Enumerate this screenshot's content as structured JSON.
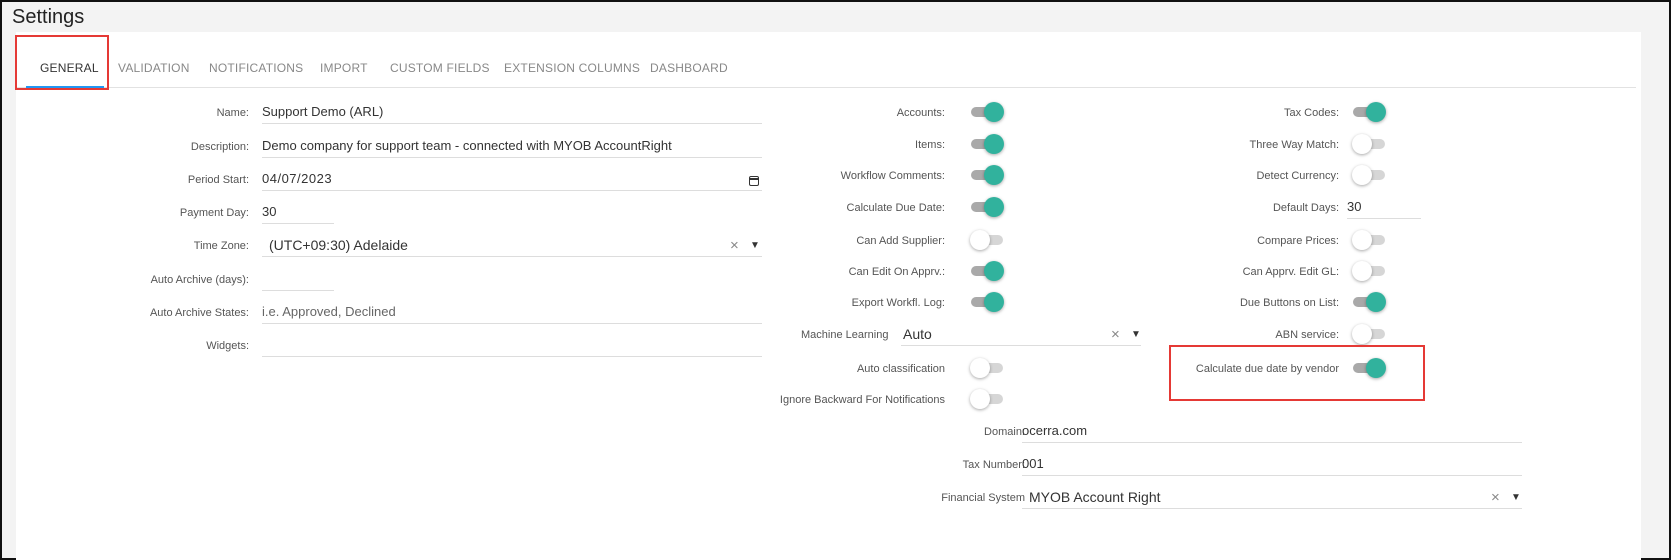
{
  "page_title": "Settings",
  "tabs": [
    {
      "label": "GENERAL",
      "active": true
    },
    {
      "label": "VALIDATION"
    },
    {
      "label": "NOTIFICATIONS"
    },
    {
      "label": "IMPORT"
    },
    {
      "label": "CUSTOM FIELDS"
    },
    {
      "label": "EXTENSION COLUMNS"
    },
    {
      "label": "DASHBOARD"
    }
  ],
  "general": {
    "name": {
      "label": "Name:",
      "value": "Support Demo (ARL)"
    },
    "description": {
      "label": "Description:",
      "value": "Demo company for support team - connected with MYOB AccountRight"
    },
    "period_start": {
      "label": "Period Start:",
      "value": "04/07/2023"
    },
    "payment_day": {
      "label": "Payment Day:",
      "value": "30"
    },
    "time_zone": {
      "label": "Time Zone:",
      "value": "(UTC+09:30) Adelaide"
    },
    "auto_archive_days": {
      "label": "Auto Archive (days):",
      "value": ""
    },
    "auto_archive_states": {
      "label": "Auto Archive States:",
      "placeholder": "i.e. Approved, Declined"
    },
    "widgets": {
      "label": "Widgets:",
      "value": ""
    }
  },
  "middle": {
    "accounts": {
      "label": "Accounts:",
      "on": true
    },
    "items": {
      "label": "Items:",
      "on": true
    },
    "workflow_comments": {
      "label": "Workflow Comments:",
      "on": true
    },
    "calculate_due_date": {
      "label": "Calculate Due Date:",
      "on": true
    },
    "can_add_supplier": {
      "label": "Can Add Supplier:",
      "on": false
    },
    "can_edit_on_apprv": {
      "label": "Can Edit On Apprv.:",
      "on": true
    },
    "export_workfl_log": {
      "label": "Export Workfl. Log:",
      "on": true
    },
    "machine_learning": {
      "label": "Machine Learning",
      "value": "Auto"
    },
    "auto_classification": {
      "label": "Auto classification",
      "on": false
    },
    "ignore_backward": {
      "label": "Ignore Backward For Notifications",
      "on": false
    },
    "domain": {
      "label": "Domain:",
      "value": "ocerra.com"
    },
    "tax_number": {
      "label": "Tax Number:",
      "value": "001"
    },
    "financial_system": {
      "label": "Financial System",
      "value": "MYOB Account Right"
    }
  },
  "right": {
    "tax_codes": {
      "label": "Tax Codes:",
      "on": true
    },
    "three_way_match": {
      "label": "Three Way Match:",
      "on": false
    },
    "detect_currency": {
      "label": "Detect Currency:",
      "on": false
    },
    "default_days": {
      "label": "Default Days:",
      "value": "30"
    },
    "compare_prices": {
      "label": "Compare Prices:",
      "on": false
    },
    "can_apprv_edit_gl": {
      "label": "Can Apprv. Edit GL:",
      "on": false
    },
    "due_buttons_on_list": {
      "label": "Due Buttons on List:",
      "on": true
    },
    "abn_service": {
      "label": "ABN service:",
      "on": false
    },
    "calc_due_by_vendor": {
      "label": "Calculate due date by vendor",
      "on": true
    }
  },
  "icons": {
    "clear": "×",
    "dropdown": "▼"
  },
  "colors": {
    "accent_toggle": "#31b29d",
    "tab_underline": "#2196f3",
    "highlight_box": "#e53935"
  }
}
